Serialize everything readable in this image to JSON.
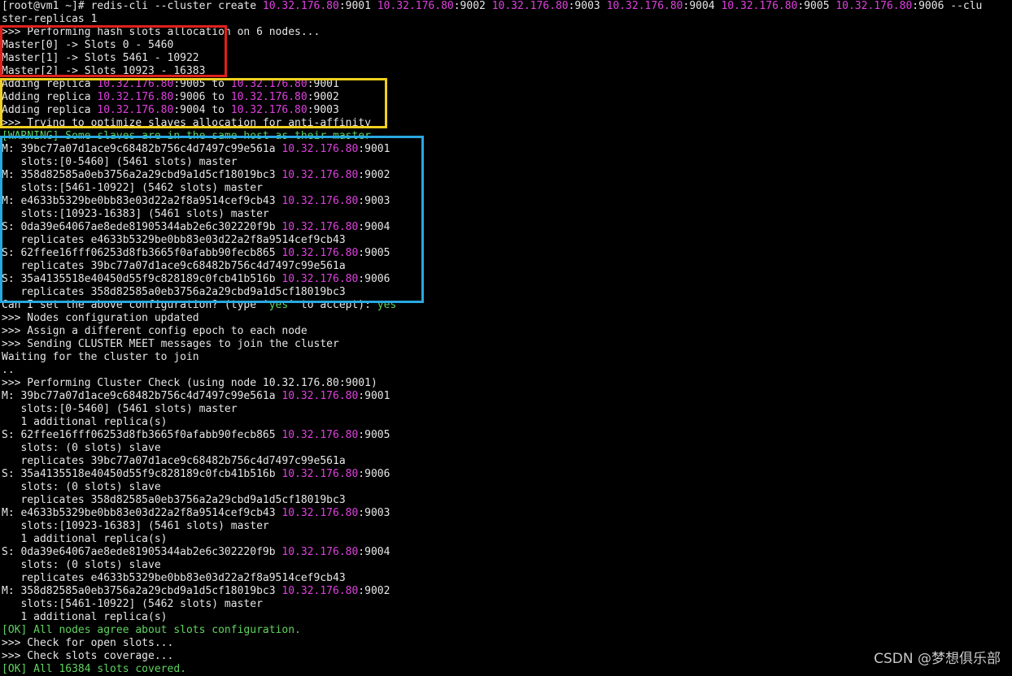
{
  "colors": {
    "background": "#000000",
    "text": "#e6e6e6",
    "ip_highlight": "#e040e0",
    "ok_green": "#5fd35f",
    "annotation_red": "#e0201c",
    "annotation_yellow": "#f0d020",
    "annotation_blue": "#28a8e0"
  },
  "terminal": {
    "lines": [
      {
        "segments": [
          {
            "t": "[root@vm1 ~]# redis-cli --cluster create "
          },
          {
            "t": "10.32.176.80",
            "c": "ip"
          },
          {
            "t": ":9001 "
          },
          {
            "t": "10.32.176.80",
            "c": "ip"
          },
          {
            "t": ":9002 "
          },
          {
            "t": "10.32.176.80",
            "c": "ip"
          },
          {
            "t": ":9003 "
          },
          {
            "t": "10.32.176.80",
            "c": "ip"
          },
          {
            "t": ":9004 "
          },
          {
            "t": "10.32.176.80",
            "c": "ip"
          },
          {
            "t": ":9005 "
          },
          {
            "t": "10.32.176.80",
            "c": "ip"
          },
          {
            "t": ":9006 --clu"
          }
        ]
      },
      {
        "segments": [
          {
            "t": "ster-replicas 1"
          }
        ]
      },
      {
        "segments": [
          {
            "t": ">>> Performing hash slots allocation on 6 nodes..."
          }
        ]
      },
      {
        "segments": [
          {
            "t": "Master[0] -> Slots 0 - 5460"
          }
        ]
      },
      {
        "segments": [
          {
            "t": "Master[1] -> Slots 5461 - 10922"
          }
        ]
      },
      {
        "segments": [
          {
            "t": "Master[2] -> Slots 10923 - 16383"
          }
        ]
      },
      {
        "segments": [
          {
            "t": "Adding replica "
          },
          {
            "t": "10.32.176.80",
            "c": "ip"
          },
          {
            "t": ":9005 to "
          },
          {
            "t": "10.32.176.80",
            "c": "ip"
          },
          {
            "t": ":9001"
          }
        ]
      },
      {
        "segments": [
          {
            "t": "Adding replica "
          },
          {
            "t": "10.32.176.80",
            "c": "ip"
          },
          {
            "t": ":9006 to "
          },
          {
            "t": "10.32.176.80",
            "c": "ip"
          },
          {
            "t": ":9002"
          }
        ]
      },
      {
        "segments": [
          {
            "t": "Adding replica "
          },
          {
            "t": "10.32.176.80",
            "c": "ip"
          },
          {
            "t": ":9004 to "
          },
          {
            "t": "10.32.176.80",
            "c": "ip"
          },
          {
            "t": ":9003"
          }
        ]
      },
      {
        "segments": [
          {
            "t": ">>> Trying to optimize slaves allocation for anti-affinity"
          }
        ]
      },
      {
        "segments": [
          {
            "t": "[WARNING] Some slaves are in the same host as their master",
            "c": "warn"
          }
        ]
      },
      {
        "segments": [
          {
            "t": "M: 39bc77a07d1ace9c68482b756c4d7497c99e561a "
          },
          {
            "t": "10.32.176.80",
            "c": "ip"
          },
          {
            "t": ":9001"
          }
        ]
      },
      {
        "segments": [
          {
            "t": "   slots:[0-5460] (5461 slots) master"
          }
        ]
      },
      {
        "segments": [
          {
            "t": "M: 358d82585a0eb3756a2a29cbd9a1d5cf18019bc3 "
          },
          {
            "t": "10.32.176.80",
            "c": "ip"
          },
          {
            "t": ":9002"
          }
        ]
      },
      {
        "segments": [
          {
            "t": "   slots:[5461-10922] (5462 slots) master"
          }
        ]
      },
      {
        "segments": [
          {
            "t": "M: e4633b5329be0bb83e03d22a2f8a9514cef9cb43 "
          },
          {
            "t": "10.32.176.80",
            "c": "ip"
          },
          {
            "t": ":9003"
          }
        ]
      },
      {
        "segments": [
          {
            "t": "   slots:[10923-16383] (5461 slots) master"
          }
        ]
      },
      {
        "segments": [
          {
            "t": "S: 0da39e64067ae8ede81905344ab2e6c302220f9b "
          },
          {
            "t": "10.32.176.80",
            "c": "ip"
          },
          {
            "t": ":9004"
          }
        ]
      },
      {
        "segments": [
          {
            "t": "   replicates e4633b5329be0bb83e03d22a2f8a9514cef9cb43"
          }
        ]
      },
      {
        "segments": [
          {
            "t": "S: 62ffee16fff06253d8fb3665f0afabb90fecb865 "
          },
          {
            "t": "10.32.176.80",
            "c": "ip"
          },
          {
            "t": ":9005"
          }
        ]
      },
      {
        "segments": [
          {
            "t": "   replicates 39bc77a07d1ace9c68482b756c4d7497c99e561a"
          }
        ]
      },
      {
        "segments": [
          {
            "t": "S: 35a4135518e40450d55f9c828189c0fcb41b516b "
          },
          {
            "t": "10.32.176.80",
            "c": "ip"
          },
          {
            "t": ":9006"
          }
        ]
      },
      {
        "segments": [
          {
            "t": "   replicates 358d82585a0eb3756a2a29cbd9a1d5cf18019bc3"
          }
        ]
      },
      {
        "segments": [
          {
            "t": "Can I set the above configuration? (type '"
          },
          {
            "t": "yes",
            "c": "yes"
          },
          {
            "t": "' to accept): "
          },
          {
            "t": "yes",
            "c": "yes"
          }
        ]
      },
      {
        "segments": [
          {
            "t": ">>> Nodes configuration updated"
          }
        ]
      },
      {
        "segments": [
          {
            "t": ">>> Assign a different config epoch to each node"
          }
        ]
      },
      {
        "segments": [
          {
            "t": ">>> Sending CLUSTER MEET messages to join the cluster"
          }
        ]
      },
      {
        "segments": [
          {
            "t": "Waiting for the cluster to join"
          }
        ]
      },
      {
        "segments": [
          {
            "t": ".."
          }
        ]
      },
      {
        "segments": [
          {
            "t": ">>> Performing Cluster Check (using node 10.32.176.80:9001)"
          }
        ]
      },
      {
        "segments": [
          {
            "t": "M: 39bc77a07d1ace9c68482b756c4d7497c99e561a "
          },
          {
            "t": "10.32.176.80",
            "c": "ip"
          },
          {
            "t": ":9001"
          }
        ]
      },
      {
        "segments": [
          {
            "t": "   slots:[0-5460] (5461 slots) master"
          }
        ]
      },
      {
        "segments": [
          {
            "t": "   1 additional replica(s)"
          }
        ]
      },
      {
        "segments": [
          {
            "t": "S: 62ffee16fff06253d8fb3665f0afabb90fecb865 "
          },
          {
            "t": "10.32.176.80",
            "c": "ip"
          },
          {
            "t": ":9005"
          }
        ]
      },
      {
        "segments": [
          {
            "t": "   slots: (0 slots) slave"
          }
        ]
      },
      {
        "segments": [
          {
            "t": "   replicates 39bc77a07d1ace9c68482b756c4d7497c99e561a"
          }
        ]
      },
      {
        "segments": [
          {
            "t": "S: 35a4135518e40450d55f9c828189c0fcb41b516b "
          },
          {
            "t": "10.32.176.80",
            "c": "ip"
          },
          {
            "t": ":9006"
          }
        ]
      },
      {
        "segments": [
          {
            "t": "   slots: (0 slots) slave"
          }
        ]
      },
      {
        "segments": [
          {
            "t": "   replicates 358d82585a0eb3756a2a29cbd9a1d5cf18019bc3"
          }
        ]
      },
      {
        "segments": [
          {
            "t": "M: e4633b5329be0bb83e03d22a2f8a9514cef9cb43 "
          },
          {
            "t": "10.32.176.80",
            "c": "ip"
          },
          {
            "t": ":9003"
          }
        ]
      },
      {
        "segments": [
          {
            "t": "   slots:[10923-16383] (5461 slots) master"
          }
        ]
      },
      {
        "segments": [
          {
            "t": "   1 additional replica(s)"
          }
        ]
      },
      {
        "segments": [
          {
            "t": "S: 0da39e64067ae8ede81905344ab2e6c302220f9b "
          },
          {
            "t": "10.32.176.80",
            "c": "ip"
          },
          {
            "t": ":9004"
          }
        ]
      },
      {
        "segments": [
          {
            "t": "   slots: (0 slots) slave"
          }
        ]
      },
      {
        "segments": [
          {
            "t": "   replicates e4633b5329be0bb83e03d22a2f8a9514cef9cb43"
          }
        ]
      },
      {
        "segments": [
          {
            "t": "M: 358d82585a0eb3756a2a29cbd9a1d5cf18019bc3 "
          },
          {
            "t": "10.32.176.80",
            "c": "ip"
          },
          {
            "t": ":9002"
          }
        ]
      },
      {
        "segments": [
          {
            "t": "   slots:[5461-10922] (5462 slots) master"
          }
        ]
      },
      {
        "segments": [
          {
            "t": "   1 additional replica(s)"
          }
        ]
      },
      {
        "segments": [
          {
            "t": "[OK] All nodes agree about slots configuration.",
            "c": "ok"
          }
        ]
      },
      {
        "segments": [
          {
            "t": ">>> Check for open slots..."
          }
        ]
      },
      {
        "segments": [
          {
            "t": ">>> Check slots coverage..."
          }
        ]
      },
      {
        "segments": [
          {
            "t": "[OK] All 16384 slots covered.",
            "c": "ok"
          }
        ]
      }
    ]
  },
  "watermark": "CSDN @梦想俱乐部"
}
